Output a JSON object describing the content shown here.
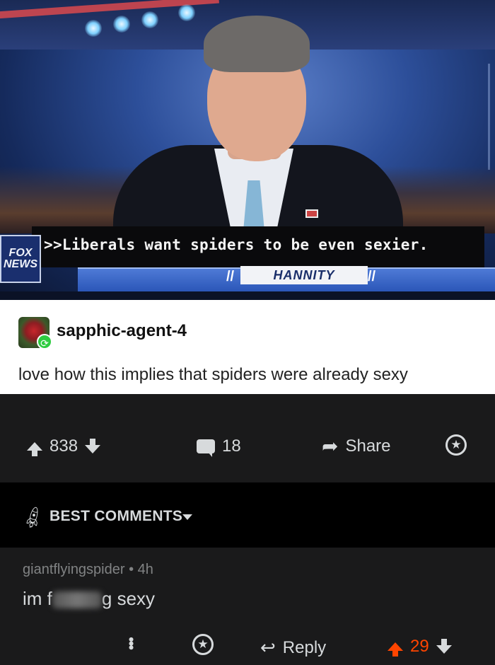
{
  "tv": {
    "caption": ">>Liberals want spiders to be even sexier.",
    "network_logo_line1": "FOX",
    "network_logo_line2": "NEWS",
    "show_name": "HANNITY"
  },
  "post": {
    "author": "sapphic-agent-4",
    "text": "love how this implies that spiders were already sexy"
  },
  "actions": {
    "upvotes": "838",
    "comments": "18",
    "share_label": "Share"
  },
  "sort": {
    "label": "BEST COMMENTS"
  },
  "comment": {
    "username": "giantflyingspider",
    "separator": "•",
    "age": "4h",
    "text_start": "im f",
    "text_end": "g sexy",
    "reply_label": "Reply",
    "score": "29"
  },
  "colors": {
    "upvote_active": "#ff4500",
    "reblog_badge": "#2ecc40",
    "app_background": "#1a1a1b"
  },
  "icons": {
    "upvote": "arrow-up-icon",
    "downvote": "arrow-down-icon",
    "comment": "comment-bubble-icon",
    "share": "share-arrow-icon",
    "award": "award-icon",
    "sort": "rocket-icon",
    "more": "more-options-icon",
    "reply": "reply-arrow-icon"
  }
}
